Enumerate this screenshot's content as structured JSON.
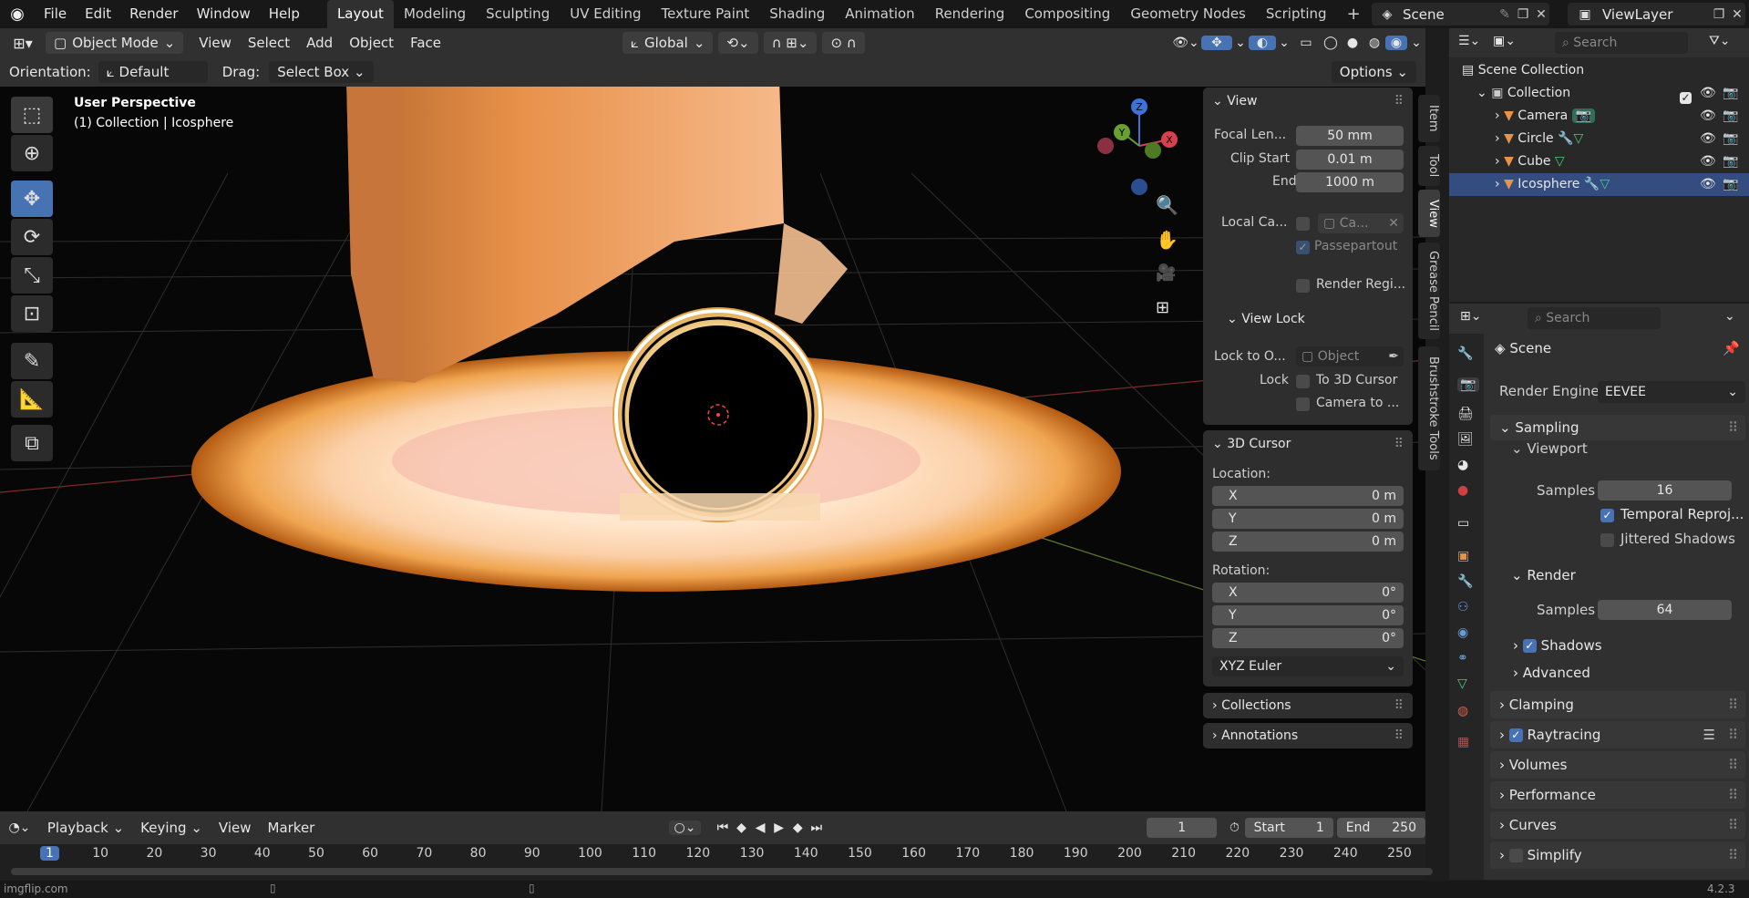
{
  "topbar": {
    "menus": [
      "File",
      "Edit",
      "Render",
      "Window",
      "Help"
    ],
    "workspaces": [
      "Layout",
      "Modeling",
      "Sculpting",
      "UV Editing",
      "Texture Paint",
      "Shading",
      "Animation",
      "Rendering",
      "Compositing",
      "Geometry Nodes",
      "Scripting"
    ],
    "active_workspace": "Layout",
    "scene": "Scene",
    "view_layer": "ViewLayer"
  },
  "viewport_header": {
    "mode": "Object Mode",
    "menus": [
      "View",
      "Select",
      "Add",
      "Object",
      "Face"
    ],
    "transform_orientation": "Global"
  },
  "tool_settings": {
    "orientation_label": "Orientation:",
    "orientation_value": "Default",
    "drag_label": "Drag:",
    "drag_value": "Select Box",
    "options": "Options"
  },
  "viewport": {
    "perspective": "User Perspective",
    "context": "(1) Collection | Icosphere",
    "gizmo_axes": [
      "Z",
      "Y",
      "X"
    ]
  },
  "npanel": {
    "tabs": [
      "Item",
      "Tool",
      "View",
      "Grease Pencil",
      "Brushstroke Tools"
    ],
    "active_tab": "View",
    "view": {
      "title": "View",
      "focal_label": "Focal Len...",
      "focal_value": "50 mm",
      "clip_start_label": "Clip Start",
      "clip_start_value": "0.01 m",
      "end_label": "End",
      "end_value": "1000 m",
      "local_cam_label": "Local Ca...",
      "local_cam_value": "Ca...",
      "passepartout": "Passepartout",
      "render_region": "Render Regi...",
      "view_lock_title": "View Lock",
      "lock_to_label": "Lock to O...",
      "lock_to_value": "Object",
      "lock_label": "Lock",
      "to_3d_cursor": "To 3D Cursor",
      "camera_to": "Camera to ..."
    },
    "cursor": {
      "title": "3D Cursor",
      "location_label": "Location:",
      "location": [
        {
          "axis": "X",
          "value": "0 m"
        },
        {
          "axis": "Y",
          "value": "0 m"
        },
        {
          "axis": "Z",
          "value": "0 m"
        }
      ],
      "rotation_label": "Rotation:",
      "rotation": [
        {
          "axis": "X",
          "value": "0°"
        },
        {
          "axis": "Y",
          "value": "0°"
        },
        {
          "axis": "Z",
          "value": "0°"
        }
      ],
      "rotation_mode": "XYZ Euler"
    },
    "collections_title": "Collections",
    "annotations_title": "Annotations"
  },
  "outliner": {
    "search_placeholder": "Search",
    "scene_collection": "Scene Collection",
    "collection": "Collection",
    "items": [
      "Camera",
      "Circle",
      "Cube",
      "Icosphere"
    ]
  },
  "properties": {
    "search_placeholder": "Search",
    "scene_label": "Scene",
    "render_engine_label": "Render Engine",
    "render_engine_value": "EEVEE",
    "sampling": "Sampling",
    "viewport": "Viewport",
    "samples_label": "Samples",
    "viewport_samples": "16",
    "temporal_reproj": "Temporal Reproj...",
    "jittered_shadows": "Jittered Shadows",
    "render": "Render",
    "render_samples": "64",
    "shadows": "Shadows",
    "advanced": "Advanced",
    "clamping": "Clamping",
    "raytracing": "Raytracing",
    "volumes": "Volumes",
    "performance": "Performance",
    "curves": "Curves",
    "simplify": "Simplify"
  },
  "timeline": {
    "menus": [
      "Playback",
      "Keying",
      "View",
      "Marker"
    ],
    "current_frame": "1",
    "start_label": "Start",
    "start_value": "1",
    "end_label": "End",
    "end_value": "250",
    "ruler": [
      "1",
      "10",
      "20",
      "30",
      "40",
      "50",
      "60",
      "70",
      "80",
      "90",
      "100",
      "110",
      "120",
      "130",
      "140",
      "150",
      "160",
      "170",
      "180",
      "190",
      "200",
      "210",
      "220",
      "230",
      "240",
      "250"
    ]
  },
  "status": {
    "watermark": "imgflip.com",
    "version": "4.2.3"
  },
  "colors": {
    "accent": "#4772b3",
    "glow_orange": "#f0a040",
    "cube": "#e8914a"
  }
}
